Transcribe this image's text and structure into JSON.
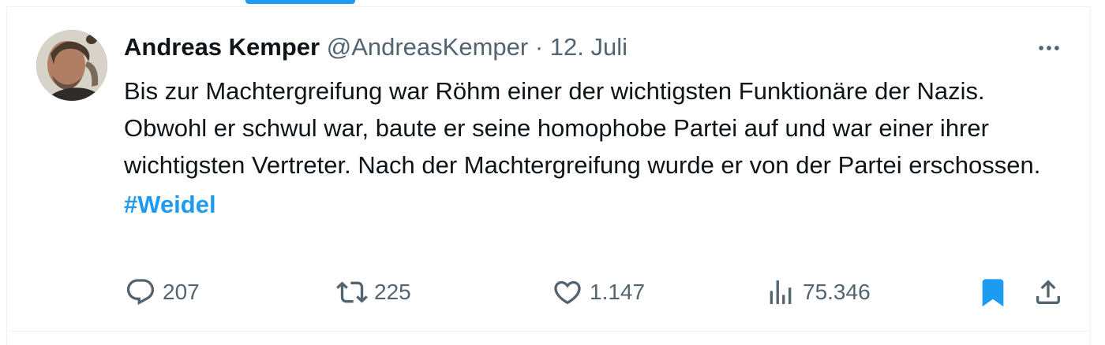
{
  "tweet": {
    "author_name": "Andreas Kemper",
    "handle": "@AndreasKemper",
    "separator": "·",
    "date": "12. Juli",
    "text": "Bis zur Machtergreifung war Röhm einer der wichtigsten Funktionäre der Nazis. Obwohl er schwul war, baute er seine homophobe Partei auf und war einer ihrer wichtigsten Vertreter. Nach der Machtergreifung wurde er von der Partei erschossen.",
    "hashtag": "#Weidel"
  },
  "actions": {
    "replies": "207",
    "reposts": "225",
    "likes": "1.147",
    "views": "75.346",
    "bookmarked": true
  },
  "icons": {
    "more": "more-horizontal-icon",
    "reply": "reply-icon",
    "repost": "repost-icon",
    "like": "heart-icon",
    "views": "views-chart-icon",
    "bookmark": "bookmark-icon",
    "share": "share-icon"
  },
  "colors": {
    "accent": "#1d9bf0",
    "text": "#0f1419",
    "muted": "#536471",
    "border": "#eff3f4"
  }
}
